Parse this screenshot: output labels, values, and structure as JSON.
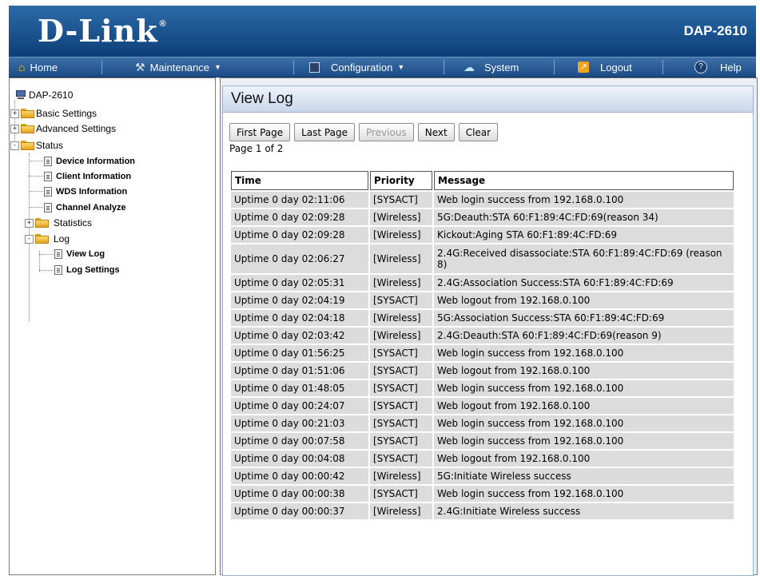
{
  "header": {
    "brand": "D-Link",
    "reg_mark": "®",
    "model": "DAP-2610"
  },
  "menu": [
    {
      "label": "Home",
      "icon": "home-icon",
      "dropdown": false
    },
    {
      "label": "Maintenance",
      "icon": "tools-icon",
      "dropdown": true
    },
    {
      "label": "Configuration",
      "icon": "save-disk-icon",
      "dropdown": true
    },
    {
      "label": "System",
      "icon": "system-icon",
      "dropdown": false
    },
    {
      "label": "Logout",
      "icon": "logout-icon",
      "dropdown": false
    },
    {
      "label": "Help",
      "icon": "help-icon",
      "dropdown": false
    }
  ],
  "sidebar": {
    "root": "DAP-2610",
    "basic": "Basic Settings",
    "advanced": "Advanced Settings",
    "status": "Status",
    "device_info": "Device Information",
    "client_info": "Client Information",
    "wds_info": "WDS Information",
    "channel": "Channel Analyze",
    "statistics": "Statistics",
    "log": "Log",
    "view_log": "View Log",
    "log_settings": "Log Settings"
  },
  "main": {
    "title": "View Log",
    "buttons": {
      "first": "First Page",
      "last": "Last Page",
      "previous": "Previous",
      "next": "Next",
      "clear": "Clear"
    },
    "page_info": "Page 1 of 2",
    "columns": [
      "Time",
      "Priority",
      "Message"
    ],
    "rows": [
      {
        "time": "Uptime 0 day 02:11:06",
        "priority": "[SYSACT]",
        "message": "Web login success from 192.168.0.100"
      },
      {
        "time": "Uptime 0 day 02:09:28",
        "priority": "[Wireless]",
        "message": "5G:Deauth:STA 60:F1:89:4C:FD:69(reason 34)"
      },
      {
        "time": "Uptime 0 day 02:09:28",
        "priority": "[Wireless]",
        "message": "Kickout:Aging STA 60:F1:89:4C:FD:69"
      },
      {
        "time": "Uptime 0 day 02:06:27",
        "priority": "[Wireless]",
        "message": "2.4G:Received disassociate:STA 60:F1:89:4C:FD:69 (reason 8)"
      },
      {
        "time": "Uptime 0 day 02:05:31",
        "priority": "[Wireless]",
        "message": "2.4G:Association Success:STA 60:F1:89:4C:FD:69"
      },
      {
        "time": "Uptime 0 day 02:04:19",
        "priority": "[SYSACT]",
        "message": "Web logout from 192.168.0.100"
      },
      {
        "time": "Uptime 0 day 02:04:18",
        "priority": "[Wireless]",
        "message": "5G:Association Success:STA 60:F1:89:4C:FD:69"
      },
      {
        "time": "Uptime 0 day 02:03:42",
        "priority": "[Wireless]",
        "message": "2.4G:Deauth:STA 60:F1:89:4C:FD:69(reason 9)"
      },
      {
        "time": "Uptime 0 day 01:56:25",
        "priority": "[SYSACT]",
        "message": "Web login success from 192.168.0.100"
      },
      {
        "time": "Uptime 0 day 01:51:06",
        "priority": "[SYSACT]",
        "message": "Web logout from 192.168.0.100"
      },
      {
        "time": "Uptime 0 day 01:48:05",
        "priority": "[SYSACT]",
        "message": "Web login success from 192.168.0.100"
      },
      {
        "time": "Uptime 0 day 00:24:07",
        "priority": "[SYSACT]",
        "message": "Web logout from 192.168.0.100"
      },
      {
        "time": "Uptime 0 day 00:21:03",
        "priority": "[SYSACT]",
        "message": "Web login success from 192.168.0.100"
      },
      {
        "time": "Uptime 0 day 00:07:58",
        "priority": "[SYSACT]",
        "message": "Web login success from 192.168.0.100"
      },
      {
        "time": "Uptime 0 day 00:04:08",
        "priority": "[SYSACT]",
        "message": "Web logout from 192.168.0.100"
      },
      {
        "time": "Uptime 0 day 00:00:42",
        "priority": "[Wireless]",
        "message": "5G:Initiate Wireless success"
      },
      {
        "time": "Uptime 0 day 00:00:38",
        "priority": "[SYSACT]",
        "message": "Web login success from 192.168.0.100"
      },
      {
        "time": "Uptime 0 day 00:00:37",
        "priority": "[Wireless]",
        "message": "2.4G:Initiate Wireless success"
      }
    ]
  },
  "colors": {
    "header_top": "#2c6aa8",
    "header_bottom": "#0d3f78",
    "row_bg": "#dcdcdc"
  }
}
